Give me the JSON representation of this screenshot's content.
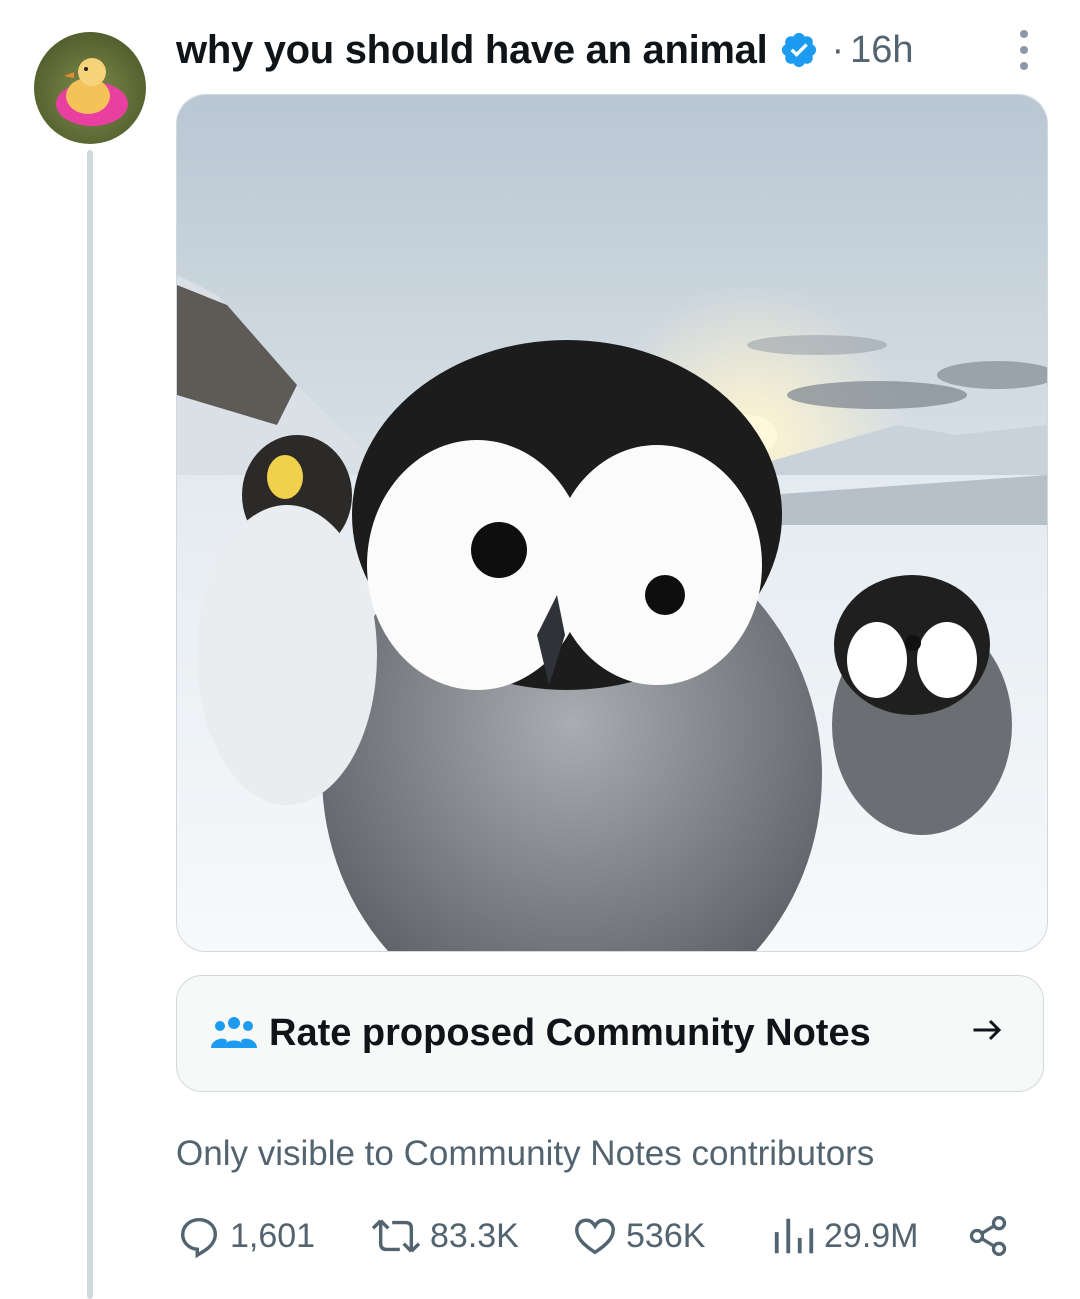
{
  "post": {
    "author_name": "why you should have an animal",
    "separator": "·",
    "time": "16h",
    "avatar_icon": "duckling-avatar",
    "verified_icon": "verified-badge-icon",
    "media_description_icon": "penguin-photo"
  },
  "community_notes": {
    "label": "Rate proposed Community Notes",
    "icon": "people-icon",
    "arrow_icon": "arrow-right-icon",
    "visibility": "Only visible to Community Notes contributors"
  },
  "actions": {
    "replies": "1,601",
    "reposts": "83.3K",
    "likes": "536K",
    "views": "29.9M"
  },
  "colors": {
    "accent": "#1d9bf0",
    "muted_text": "#536471",
    "border": "#cfd9de",
    "card_bg": "#f7f9f9"
  }
}
